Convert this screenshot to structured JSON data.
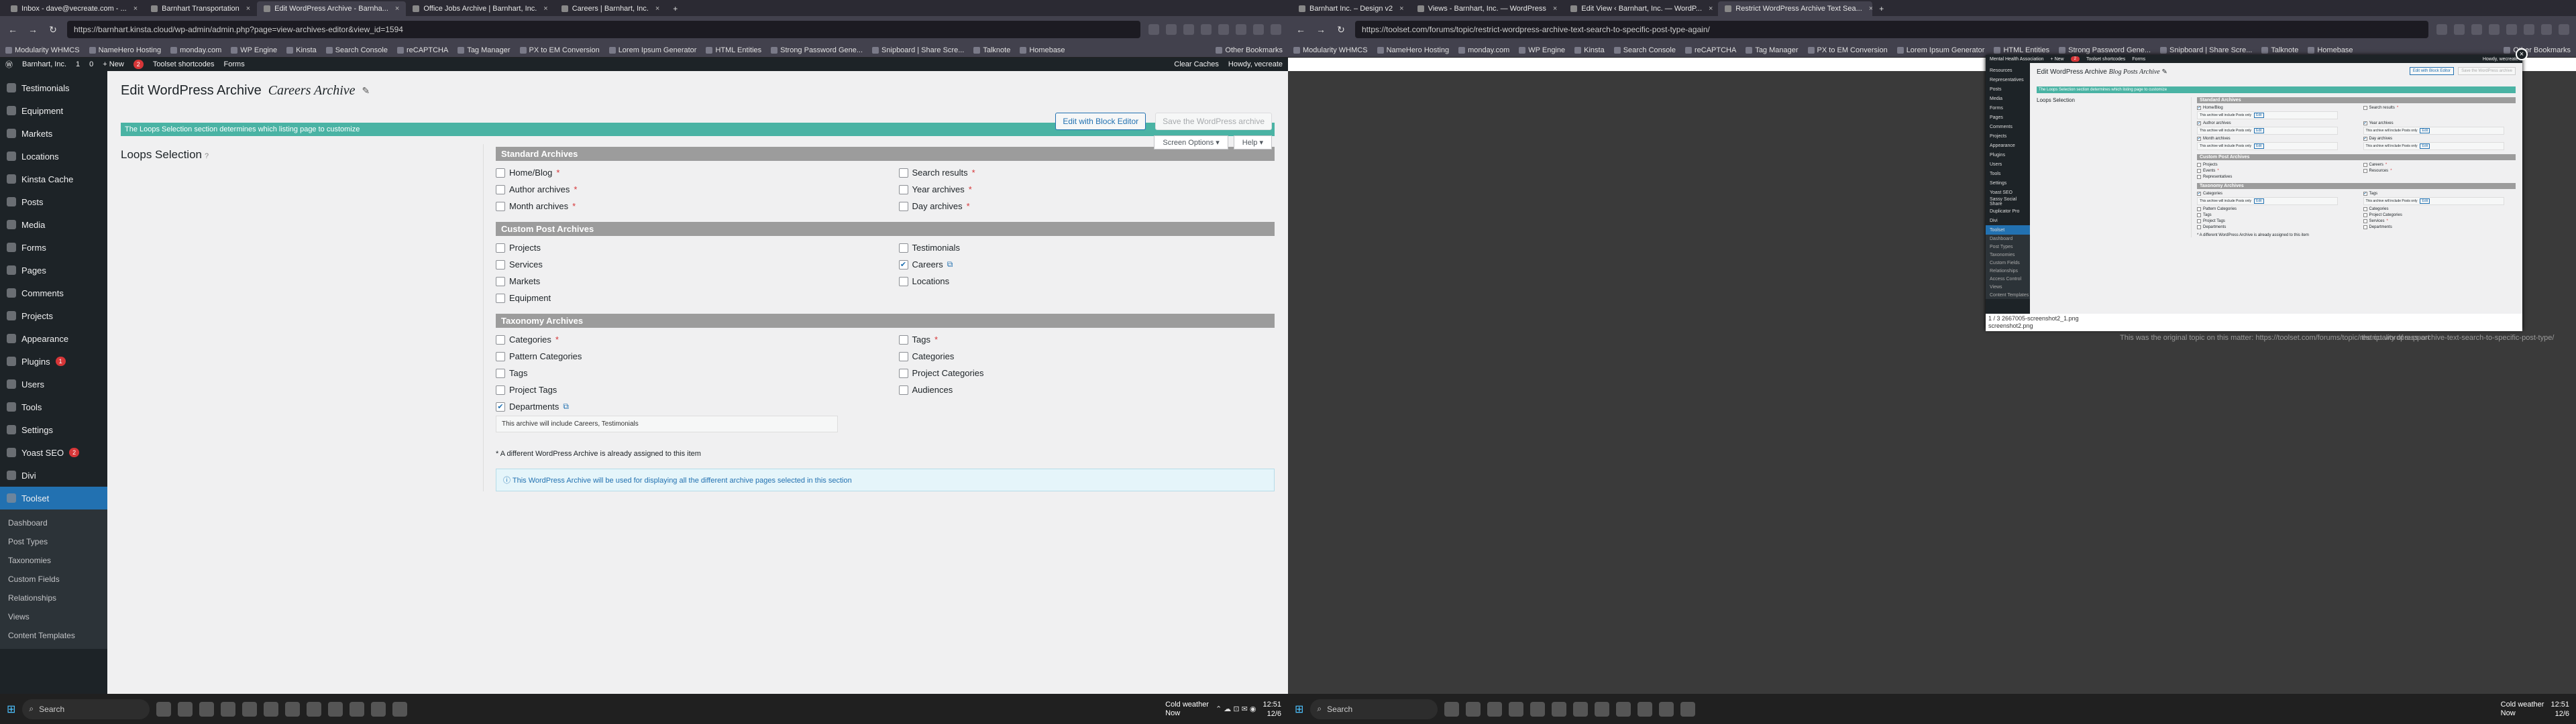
{
  "left": {
    "tabs": [
      {
        "label": "Inbox - dave@vecreate.com - ..."
      },
      {
        "label": "Barnhart Transportation"
      },
      {
        "label": "Edit WordPress Archive - Barnha..."
      },
      {
        "label": "Office Jobs Archive | Barnhart, Inc."
      },
      {
        "label": "Careers | Barnhart, Inc."
      }
    ],
    "new_tab": "+",
    "url": "https://barnhart.kinsta.cloud/wp-admin/admin.php?page=view-archives-editor&view_id=1594",
    "bookmarks": [
      "Modularity WHMCS",
      "NameHero Hosting",
      "monday.com",
      "WP Engine",
      "Kinsta",
      "Search Console",
      "reCAPTCHA",
      "Tag Manager",
      "PX to EM Conversion",
      "Lorem Ipsum Generator",
      "HTML Entities",
      "Strong Password Gene...",
      "Snipboard | Share Scre...",
      "Talknote",
      "Homebase"
    ],
    "other_bookmarks": "Other Bookmarks",
    "adminbar": {
      "site": "Barnhart, Inc.",
      "comments": "1",
      "chat": "0",
      "new": "+ New",
      "toolset_count": "2",
      "toolset": "Toolset shortcodes",
      "forms": "Forms",
      "clear": "Clear Caches",
      "howdy": "Howdy, vecreate"
    },
    "menu": [
      {
        "label": "Testimonials"
      },
      {
        "label": "Equipment"
      },
      {
        "label": "Markets"
      },
      {
        "label": "Locations"
      },
      {
        "label": "Kinsta Cache"
      },
      {
        "label": "Posts"
      },
      {
        "label": "Media"
      },
      {
        "label": "Forms"
      },
      {
        "label": "Pages"
      },
      {
        "label": "Comments"
      },
      {
        "label": "Projects"
      },
      {
        "label": "Appearance"
      },
      {
        "label": "Plugins",
        "badge": "1"
      },
      {
        "label": "Users"
      },
      {
        "label": "Tools"
      },
      {
        "label": "Settings"
      },
      {
        "label": "Yoast SEO",
        "badge": "2"
      },
      {
        "label": "Divi"
      },
      {
        "label": "Toolset"
      }
    ],
    "submenu": [
      "Dashboard",
      "Post Types",
      "Taxonomies",
      "Custom Fields",
      "Relationships",
      "Views",
      "Content Templates"
    ],
    "page_title": "Edit WordPress Archive",
    "archive_name": "Careers Archive",
    "btn_block": "Edit with Block Editor",
    "btn_save": "Save the WordPress archive",
    "screen_options": "Screen Options ▾",
    "help": "Help ▾",
    "notice": "The Loops Selection section determines which listing page to customize",
    "loops_label": "Loops Selection",
    "sections": {
      "standard": "Standard Archives",
      "custom": "Custom Post Archives",
      "taxonomy": "Taxonomy Archives"
    },
    "standard_items": [
      {
        "label": "Home/Blog",
        "req": "*"
      },
      {
        "label": "Search results",
        "req": "*"
      },
      {
        "label": "Author archives",
        "req": "*"
      },
      {
        "label": "Year archives",
        "req": "*"
      },
      {
        "label": "Month archives",
        "req": "*"
      },
      {
        "label": "Day archives",
        "req": "*"
      }
    ],
    "custom_items": [
      {
        "label": "Projects"
      },
      {
        "label": "Testimonials"
      },
      {
        "label": "Services"
      },
      {
        "label": "Careers",
        "checked": true
      },
      {
        "label": "Markets"
      },
      {
        "label": "Locations"
      },
      {
        "label": "Equipment"
      }
    ],
    "taxonomy_items": [
      {
        "label": "Categories",
        "req": "*"
      },
      {
        "label": "Tags",
        "req": "*"
      },
      {
        "label": "Pattern Categories"
      },
      {
        "label": "Categories"
      },
      {
        "label": "Tags"
      },
      {
        "label": "Project Categories"
      },
      {
        "label": "Project Tags"
      },
      {
        "label": "Audiences"
      },
      {
        "label": "Departments",
        "checked": true
      }
    ],
    "includes": "This archive will include Careers, Testimonials",
    "footnote": "* A different WordPress Archive is already assigned to this item",
    "info": "This WordPress Archive will be used for displaying all the different archive pages selected in this section"
  },
  "right": {
    "tabs": [
      {
        "label": "Barnhart Inc. – Design v2"
      },
      {
        "label": "Views - Barnhart, Inc. — WordPress"
      },
      {
        "label": "Edit View ‹ Barnhart, Inc. — WordP..."
      },
      {
        "label": "Restrict WordPress Archive Text Sea..."
      }
    ],
    "url": "https://toolset.com/forums/topic/restrict-wordpress-archive-text-search-to-specific-post-type-again/",
    "adminbar": {
      "site": "Mental Health Association",
      "new": "+ New",
      "toolset_count": "2",
      "toolset": "Toolset shortcodes",
      "forms": "Forms",
      "howdy": "Howdy, wecreate"
    },
    "menu": [
      "Resources",
      "Representatives",
      "Posts",
      "Media",
      "Forms",
      "Pages",
      "Comments",
      "Projects",
      "Appearance",
      "Plugins",
      "Users",
      "Tools",
      "Settings",
      "Yoast SEO",
      "Sassy Social Share",
      "Duplicator Pro",
      "Divi",
      "Toolset"
    ],
    "submenu": [
      "Dashboard",
      "Post Types",
      "Taxonomies",
      "Custom Fields",
      "Relationships",
      "Access Control",
      "Views",
      "Content Templates"
    ],
    "page_title": "Edit WordPress Archive",
    "archive_name": "Blog Posts Archive",
    "btn_block": "Edit with Block Editor",
    "btn_save": "Save the WordPress archive",
    "screen_options": "Screen Options ▾",
    "help": "Help ▾",
    "notice": "The Loops Selection section determines which listing page to customize",
    "loops_label": "Loops Selection",
    "standard": [
      {
        "label": "Home/Blog",
        "checked": true,
        "incl": "This archive will include Posts only"
      },
      {
        "label": "Search results",
        "req": "*"
      },
      {
        "label": "Author archives",
        "checked": true,
        "incl": "This archive will include Posts only"
      },
      {
        "label": "Year archives",
        "checked": true,
        "incl": "This archive will include Posts only"
      },
      {
        "label": "Month archives",
        "checked": true,
        "incl": "This archive will include Posts only"
      },
      {
        "label": "Day archives",
        "checked": true,
        "incl": "This archive will include Posts only"
      }
    ],
    "custom": [
      {
        "label": "Projects"
      },
      {
        "label": "Careers",
        "req": "*"
      },
      {
        "label": "Events",
        "req": "*"
      },
      {
        "label": "Resources",
        "req": "*"
      },
      {
        "label": "Representatives"
      }
    ],
    "taxonomy": [
      {
        "label": "Categories",
        "checked": true,
        "incl": "This archive will include Posts only"
      },
      {
        "label": "Tags",
        "checked": true,
        "incl": "This archive will include Posts only"
      },
      {
        "label": "Pattern Categories"
      },
      {
        "label": "Categories"
      },
      {
        "label": "Tags"
      },
      {
        "label": "Project Categories"
      },
      {
        "label": "Project Tags"
      },
      {
        "label": "Services",
        "req": "*"
      },
      {
        "label": "Departments"
      },
      {
        "label": "Departments"
      }
    ],
    "edit": "Edit",
    "sections": {
      "standard": "Standard Archives",
      "custom": "Custom Post Archives",
      "taxonomy": "Taxonomy Archives"
    },
    "footnote": "* A different WordPress Archive is already assigned to this item",
    "caption1": "1 / 3  2667005-screenshot2_1.png",
    "caption2": "screenshot2.png",
    "close": "×",
    "behind_text": "This was the original topic on this matter: https://toolset.com/forums/topic/restrict-wordpress-archive-text-search-to-specific-post-type/",
    "behind_text2": "the quality of support"
  },
  "taskbar": {
    "search": "Search",
    "weather_title": "Cold weather",
    "weather_sub": "Now",
    "time": "12:51",
    "date": "12/6"
  }
}
